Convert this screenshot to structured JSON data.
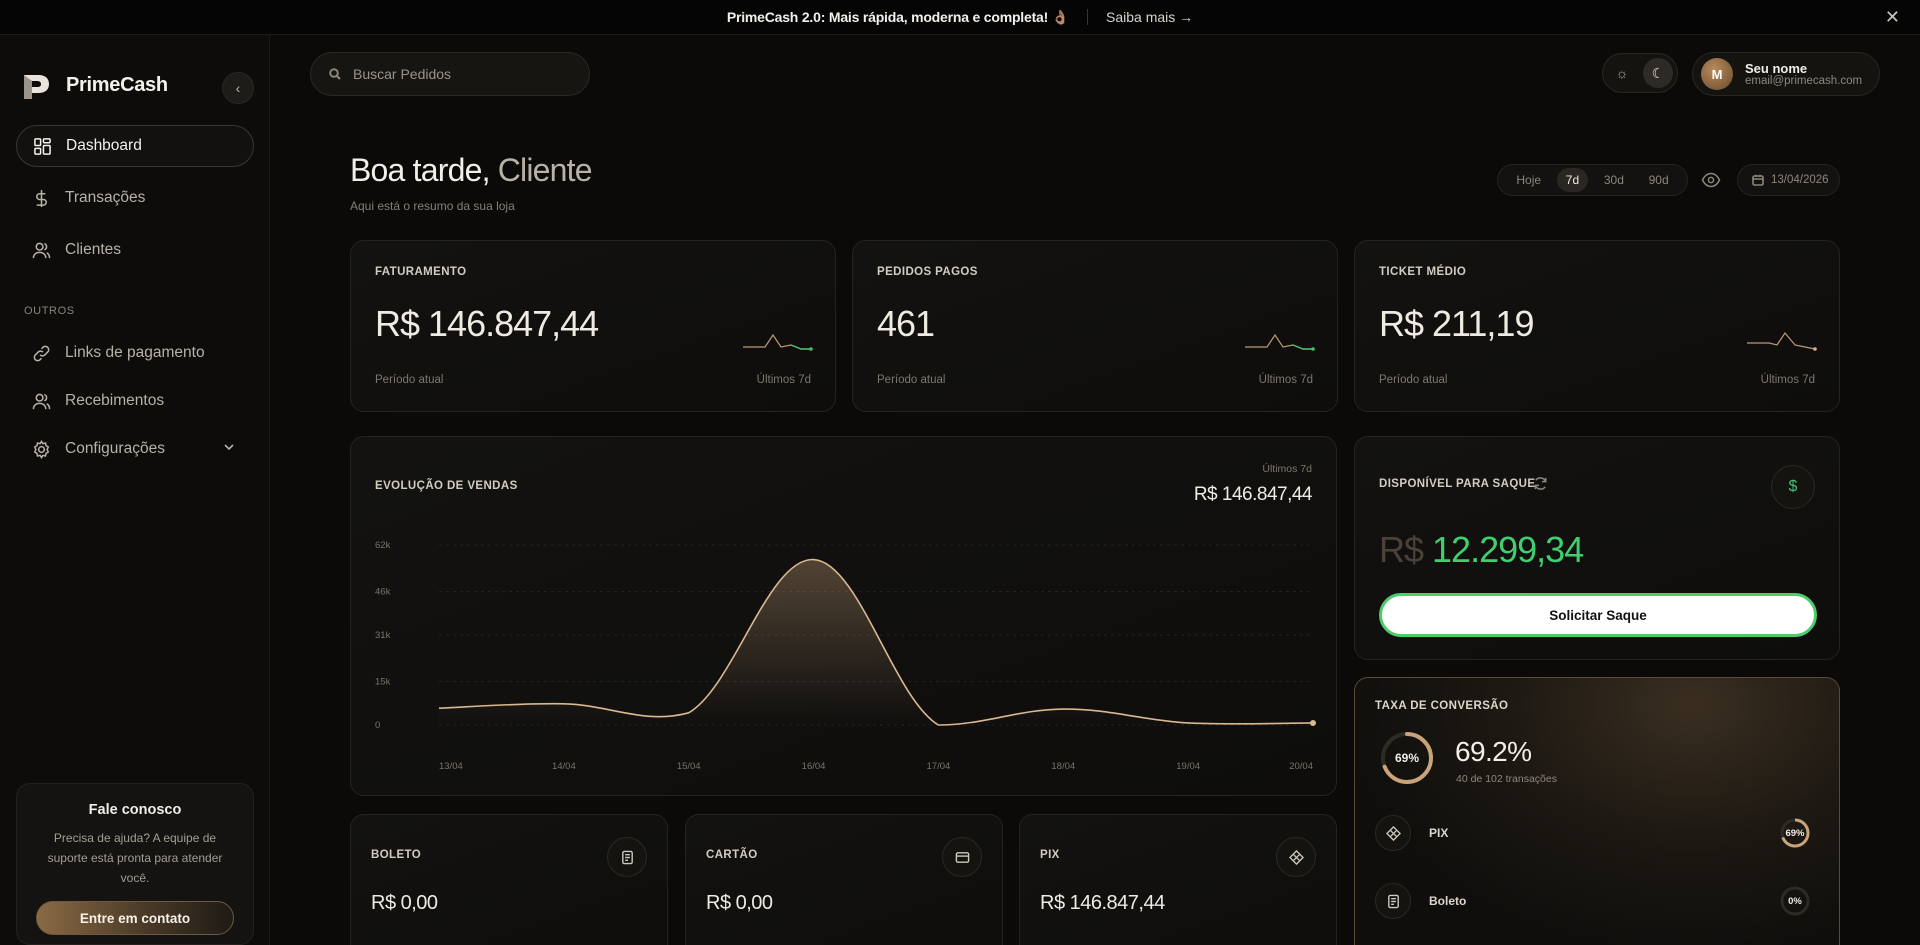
{
  "announcement": {
    "message": "PrimeCash 2.0: Mais rápida, moderna e completa! 👌🏽",
    "link": "Saiba mais →",
    "close": "✕"
  },
  "brand": {
    "name": "PrimeCash"
  },
  "sidebar": {
    "collapse_icon": "‹",
    "items": [
      {
        "label": "Dashboard",
        "icon": "grid-icon"
      },
      {
        "label": "Transações",
        "icon": "dollar-icon"
      },
      {
        "label": "Clientes",
        "icon": "users-icon"
      }
    ],
    "section_label": "OUTROS",
    "other_items": [
      {
        "label": "Links de pagamento",
        "icon": "link-icon"
      },
      {
        "label": "Recebimentos",
        "icon": "users-icon"
      },
      {
        "label": "Configurações",
        "icon": "gear-icon"
      }
    ]
  },
  "help": {
    "title": "Fale conosco",
    "description": "Precisa de ajuda? A equipe de suporte está pronta para atender você.",
    "button": "Entre em contato"
  },
  "search": {
    "placeholder": "Buscar Pedidos"
  },
  "theme": {
    "light_icon": "☼",
    "dark_icon": "☾"
  },
  "user": {
    "initial": "M",
    "name": "Seu nome",
    "email": "email@primecash.com"
  },
  "greeting": {
    "prefix": "Boa tarde, ",
    "name": "Cliente",
    "subtitle": "Aqui está o resumo da sua loja"
  },
  "range": {
    "options": [
      "Hoje",
      "7d",
      "30d",
      "90d"
    ],
    "selected": "7d",
    "date": "13/04/2026"
  },
  "kpis": [
    {
      "label": "FATURAMENTO",
      "value": "R$ 146.847,44",
      "foot_left": "Período atual",
      "foot_right": "Últimos 7d"
    },
    {
      "label": "PEDIDOS PAGOS",
      "value": "461",
      "foot_left": "Período atual",
      "foot_right": "Últimos 7d"
    },
    {
      "label": "TICKET MÉDIO",
      "value": "R$ 211,19",
      "foot_left": "Período atual",
      "foot_right": "Últimos 7d"
    }
  ],
  "sales_chart": {
    "title": "EVOLUÇÃO DE VENDAS",
    "period": "Últimos 7d",
    "total": "R$ 146.847,44"
  },
  "chart_data": {
    "type": "area",
    "title": "EVOLUÇÃO DE VENDAS",
    "xlabel": "",
    "ylabel": "",
    "categories": [
      "13/04",
      "14/04",
      "15/04",
      "16/04",
      "17/04",
      "18/04",
      "19/04",
      "20/04"
    ],
    "ytick_labels": [
      "62k",
      "46k",
      "31k",
      "15k",
      "0"
    ],
    "ytick_values": [
      62000,
      46000,
      31000,
      15000,
      0
    ],
    "ylim": [
      0,
      62000
    ],
    "series": [
      {
        "values": [
          5800,
          7300,
          4200,
          57000,
          0,
          5500,
          700,
          700
        ]
      }
    ],
    "grid": true,
    "line_color": "#d9b892"
  },
  "withdraw": {
    "label": "DISPONÍVEL PARA SAQUE",
    "currency": "R$ ",
    "amount": "12.299,34",
    "button": "Solicitar Saque",
    "badge": "$"
  },
  "conversion": {
    "title": "TAXA DE CONVERSÃO",
    "ring_label": "69%",
    "ring_fraction": 0.69,
    "value": "69.2%",
    "subtitle": "40 de 102 transações",
    "rows": [
      {
        "label": "PIX",
        "pct": "69%",
        "fraction": 0.69
      },
      {
        "label": "Boleto",
        "pct": "0%",
        "fraction": 0
      }
    ]
  },
  "payments": [
    {
      "label": "BOLETO",
      "value": "R$ 0,00"
    },
    {
      "label": "CARTÃO",
      "value": "R$ 0,00"
    },
    {
      "label": "PIX",
      "value": "R$ 146.847,44"
    }
  ],
  "colors": {
    "accent": "#c9a37a",
    "positive": "#3fcf6e",
    "background": "#0b0a09"
  }
}
